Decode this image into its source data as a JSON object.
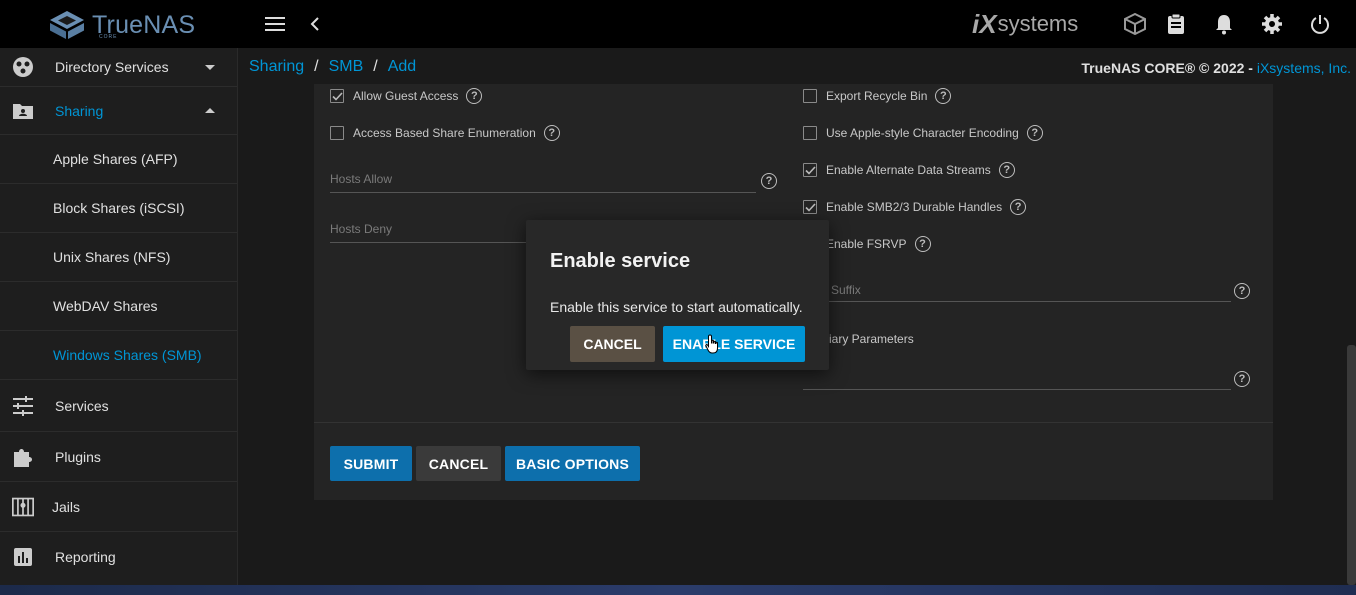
{
  "topbar": {
    "logo_text": "TrueNAS",
    "logo_sub": "CORE",
    "vendor_logo_ix": "iX",
    "vendor_logo_systems": "systems"
  },
  "sidebar": {
    "items": [
      {
        "label": "Directory Services",
        "icon": "directory-services-icon"
      },
      {
        "label": "Sharing",
        "icon": "sharing-folder-icon"
      },
      {
        "label": "Services",
        "icon": "tune-icon"
      },
      {
        "label": "Plugins",
        "icon": "puzzle-icon"
      },
      {
        "label": "Jails",
        "icon": "jail-icon"
      },
      {
        "label": "Reporting",
        "icon": "bar-chart-icon"
      }
    ],
    "sharing_sub": [
      {
        "label": "Apple Shares (AFP)"
      },
      {
        "label": "Block Shares (iSCSI)"
      },
      {
        "label": "Unix Shares (NFS)"
      },
      {
        "label": "WebDAV Shares"
      },
      {
        "label": "Windows Shares (SMB)"
      }
    ]
  },
  "breadcrumb": [
    "Sharing",
    "SMB",
    "Add"
  ],
  "copyright": {
    "text": "TrueNAS CORE® © 2022 - ",
    "link": "iXsystems, Inc."
  },
  "form": {
    "left_checkboxes": [
      {
        "label": "Allow Guest Access",
        "checked": true
      },
      {
        "label": "Access Based Share Enumeration",
        "checked": false
      }
    ],
    "hosts_allow_placeholder": "Hosts Allow",
    "hosts_deny_placeholder": "Hosts Deny",
    "right_checkboxes": [
      {
        "label": "Export Recycle Bin",
        "checked": false
      },
      {
        "label": "Use Apple-style Character Encoding",
        "checked": false
      },
      {
        "label": "Enable Alternate Data Streams",
        "checked": true
      },
      {
        "label": "Enable SMB2/3 Durable Handles",
        "checked": true
      },
      {
        "label": "Enable FSRVP",
        "checked": false
      }
    ],
    "suffix_partial": "Suffix",
    "aux_partial": "iary Parameters",
    "help_glyph": "?",
    "buttons": {
      "submit": "SUBMIT",
      "cancel": "CANCEL",
      "basic": "BASIC OPTIONS"
    }
  },
  "dialog": {
    "title": "Enable service",
    "message": "Enable this service to start automatically.",
    "cancel": "CANCEL",
    "confirm": "ENABLE SERVICE"
  },
  "colors": {
    "accent": "#0095d5",
    "primary_button": "#0d6fac",
    "dialog_cancel": "#5a5044"
  }
}
